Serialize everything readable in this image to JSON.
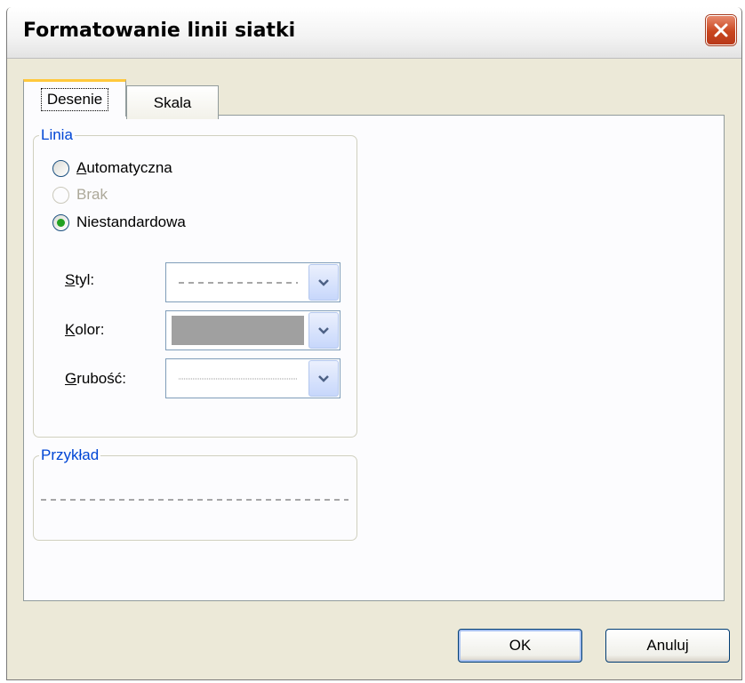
{
  "window": {
    "title": "Formatowanie linii siatki"
  },
  "tabs": [
    {
      "label": "Desenie",
      "active": true
    },
    {
      "label": "Skala",
      "active": false
    }
  ],
  "linia": {
    "group_title": "Linia",
    "options": [
      {
        "label": "Automatyczna",
        "accel": "A",
        "rest": "utomatyczna",
        "selected": false,
        "disabled": false
      },
      {
        "label": "Brak",
        "selected": false,
        "disabled": true
      },
      {
        "label": "Niestandardowa",
        "selected": true,
        "disabled": false
      }
    ],
    "fields": {
      "styl": {
        "label": "Styl:",
        "accel": "S",
        "rest": "tyl:",
        "value": "dashed"
      },
      "kolor": {
        "label": "Kolor:",
        "accel": "K",
        "rest": "olor:",
        "value_color": "#a0a0a0"
      },
      "grubosc": {
        "label": "Grubość:",
        "accel": "G",
        "rest": "rubość:",
        "value": "hairline"
      }
    }
  },
  "przyklad": {
    "group_title": "Przykład"
  },
  "buttons": {
    "ok": "OK",
    "cancel": "Anuluj"
  },
  "colors": {
    "dialog_bg": "#ece9d8",
    "panel_bg": "#fcfcfe",
    "group_title": "#0046d5",
    "close_btn": "#c9461f"
  }
}
